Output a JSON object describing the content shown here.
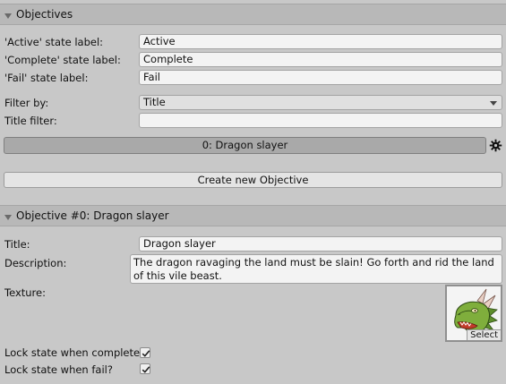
{
  "objectives_header": {
    "title": "Objectives"
  },
  "state_labels": {
    "active": {
      "label": "'Active' state label:",
      "value": "Active"
    },
    "complete": {
      "label": "'Complete' state label:",
      "value": "Complete"
    },
    "fail": {
      "label": "'Fail' state label:",
      "value": "Fail"
    }
  },
  "filter": {
    "filter_by_label": "Filter by:",
    "filter_by_value": "Title",
    "title_filter_label": "Title filter:",
    "title_filter_value": ""
  },
  "objective_list": {
    "items": [
      {
        "label": "0: Dragon slayer"
      }
    ],
    "options_icon": "gear-icon"
  },
  "create_button": {
    "label": "Create new Objective"
  },
  "objective_detail": {
    "header_title": "Objective #0: Dragon slayer",
    "title_label": "Title:",
    "title_value": "Dragon slayer",
    "description_label": "Description:",
    "description_value": "The dragon ravaging the land must be slain!  Go forth and rid the land of this vile beast.",
    "texture_label": "Texture:",
    "texture_image": "green-dragon-head",
    "texture_select_label": "Select",
    "lock_complete_label": "Lock state when complete",
    "lock_complete_checked": true,
    "lock_fail_label": "Lock state when fail?",
    "lock_fail_checked": true
  },
  "colors": {
    "panel_bg": "#c8c8c8",
    "header_bg": "#b8b8b8",
    "field_bg": "#f3f3f3",
    "list_item_bg": "#a9a9a9"
  }
}
